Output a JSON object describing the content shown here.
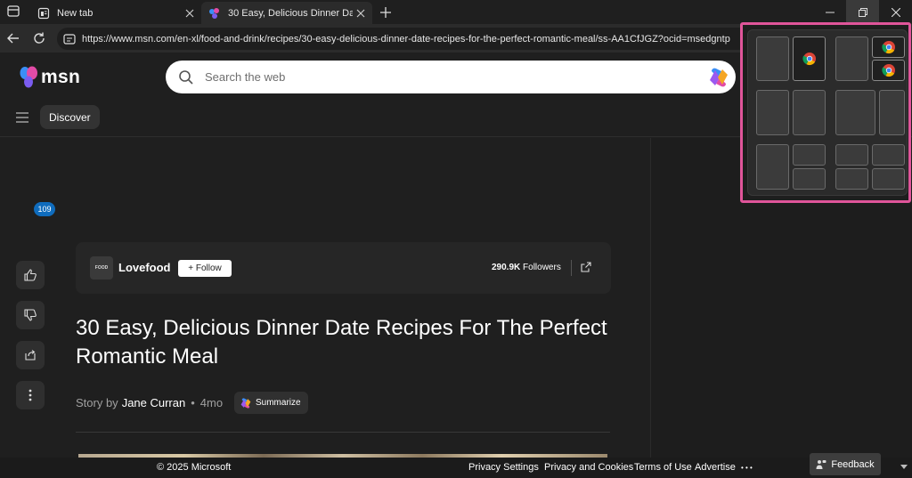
{
  "browser": {
    "tabs": [
      {
        "title": "New tab",
        "icon": "newtab-icon"
      },
      {
        "title": "30 Easy, Delicious Dinner Date Re",
        "icon": "msn-icon",
        "active": true
      }
    ],
    "url": "https://www.msn.com/en-xl/food-and-drink/recipes/30-easy-delicious-dinner-date-recipes-for-the-perfect-romantic-meal/ss-AA1CfJGZ?ocid=msedgntp"
  },
  "header": {
    "logo_text": "msn",
    "search_placeholder": "Search the web",
    "nav_label": "Discover"
  },
  "article": {
    "like_count": "109",
    "publisher": "Lovefood",
    "publisher_logo_text": "FOOD",
    "follow_label": "+ Follow",
    "followers_count": "290.9K",
    "followers_label": "Followers",
    "headline": "30 Easy, Delicious Dinner Date Recipes For The Perfect Romantic Meal",
    "story_by": "Story by",
    "author": "Jane Curran",
    "age": "4mo",
    "summarize_label": "Summarize"
  },
  "footer": {
    "copyright": "© 2025 Microsoft",
    "links": [
      "Privacy Settings",
      "Privacy and Cookies",
      "Terms of Use",
      "Advertise"
    ],
    "more": "• • •",
    "feedback": "Feedback"
  },
  "colors": {
    "accent": "#e0559a",
    "badge": "#0f6cbd"
  }
}
